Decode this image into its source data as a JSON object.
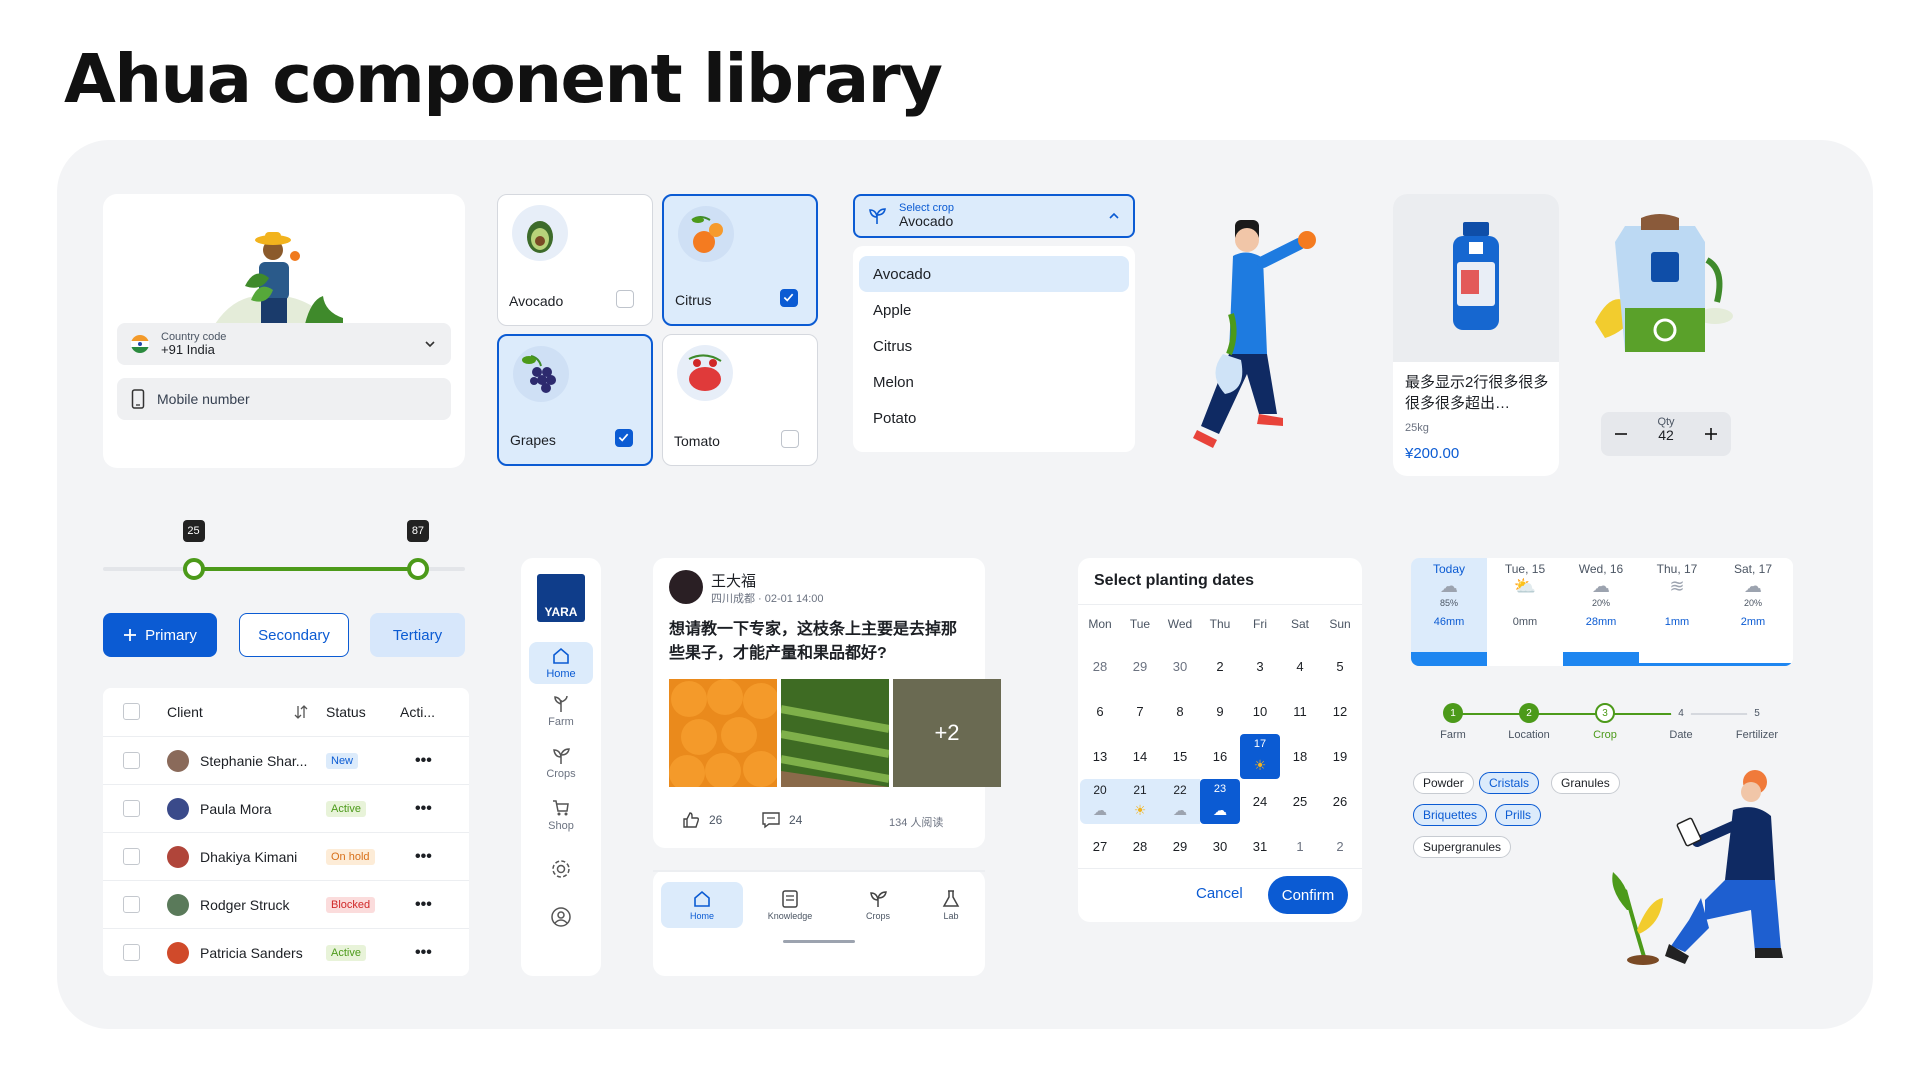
{
  "page": {
    "title": "Ahua component library"
  },
  "login": {
    "country_label": "Country code",
    "country_value": "+91 India",
    "mobile_placeholder": "Mobile number"
  },
  "crops": [
    {
      "name": "Avocado",
      "selected": false
    },
    {
      "name": "Citrus",
      "selected": true
    },
    {
      "name": "Grapes",
      "selected": true
    },
    {
      "name": "Tomato",
      "selected": false
    }
  ],
  "dropdown": {
    "label": "Select crop",
    "value": "Avocado",
    "options": [
      "Avocado",
      "Apple",
      "Citrus",
      "Melon",
      "Potato"
    ]
  },
  "product": {
    "name": "最多显示2行很多很多很多很多超出…",
    "weight": "25kg",
    "price": "¥200.00"
  },
  "qty": {
    "label": "Qty",
    "value": "42"
  },
  "slider": {
    "min_value": "25",
    "max_value": "87",
    "range_start": 0.25,
    "range_end": 0.87
  },
  "buttons": {
    "primary": "Primary",
    "secondary": "Secondary",
    "tertiary": "Tertiary"
  },
  "table": {
    "headers": [
      "Client",
      "Status",
      "Acti..."
    ],
    "rows": [
      {
        "client": "Stephanie Shar...",
        "status": "New"
      },
      {
        "client": "Paula Mora",
        "status": "Active"
      },
      {
        "client": "Dhakiya Kimani",
        "status": "On hold"
      },
      {
        "client": "Rodger Struck",
        "status": "Blocked"
      },
      {
        "client": "Patricia Sanders",
        "status": "Active"
      }
    ]
  },
  "nav_rail": {
    "logo": "YARA",
    "items": [
      "Home",
      "Farm",
      "Crops",
      "Shop"
    ]
  },
  "post": {
    "author": "王大福",
    "meta": "四川成都 · 02-01 14:00",
    "text": "想请教一下专家，这枝条上主要是去掉那些果子，才能产量和果品都好?",
    "more_images": "+2",
    "likes": "26",
    "comments": "24",
    "reads": "134 人阅读"
  },
  "bottom_nav": [
    "Home",
    "Knowledge",
    "Crops",
    "Lab"
  ],
  "calendar": {
    "title": "Select planting dates",
    "weekdays": [
      "Mon",
      "Tue",
      "Wed",
      "Thu",
      "Fri",
      "Sat",
      "Sun"
    ],
    "days": [
      "28",
      "29",
      "30",
      "2",
      "3",
      "4",
      "5",
      "6",
      "7",
      "8",
      "9",
      "10",
      "11",
      "12",
      "13",
      "14",
      "15",
      "16",
      "17",
      "18",
      "19",
      "20",
      "21",
      "22",
      "23",
      "24",
      "25",
      "26",
      "27",
      "28",
      "29",
      "30",
      "31",
      "1",
      "2"
    ],
    "cancel": "Cancel",
    "confirm": "Confirm"
  },
  "weather": [
    {
      "day": "Today",
      "pct": "85%",
      "mm": "46mm"
    },
    {
      "day": "Tue, 15",
      "pct": "",
      "mm": "0mm"
    },
    {
      "day": "Wed, 16",
      "pct": "20%",
      "mm": "28mm"
    },
    {
      "day": "Thu, 17",
      "pct": "",
      "mm": "1mm"
    },
    {
      "day": "Sat, 17",
      "pct": "20%",
      "mm": "2mm"
    }
  ],
  "stepper": [
    {
      "num": "1",
      "label": "Farm"
    },
    {
      "num": "2",
      "label": "Location"
    },
    {
      "num": "3",
      "label": "Crop"
    },
    {
      "num": "4",
      "label": "Date"
    },
    {
      "num": "5",
      "label": "Fertilizer"
    }
  ],
  "chips": [
    "Powder",
    "Cristals",
    "Granules",
    "Briquettes",
    "Prills",
    "Supergranules"
  ],
  "colors": {
    "primary": "#0b5bd3",
    "green": "#4c9a1a",
    "surface": "#f3f4f6"
  }
}
